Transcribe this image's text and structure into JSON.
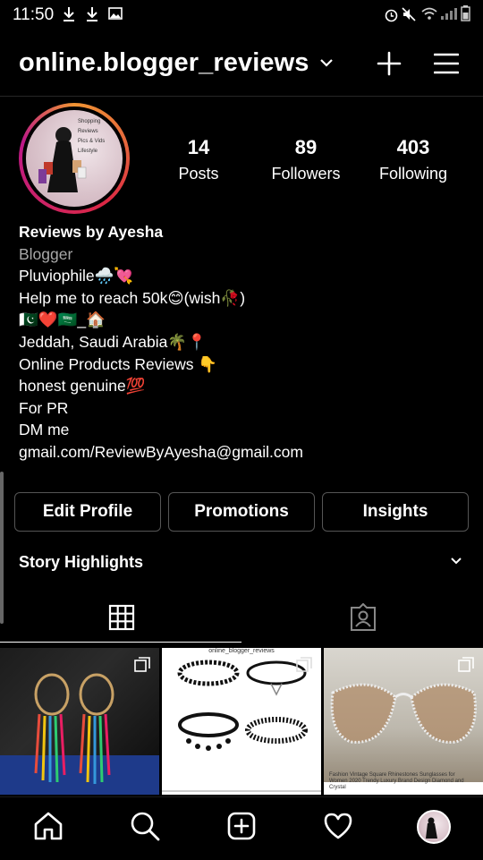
{
  "status_bar": {
    "time": "11:50",
    "left_icons": [
      "download-icon",
      "download-icon",
      "image-icon"
    ],
    "right_icons": [
      "alarm-icon",
      "mute-icon",
      "wifi-icon",
      "signal-icon",
      "battery-icon"
    ]
  },
  "header": {
    "username": "online.blogger_reviews",
    "icons": [
      "chevron-down-icon",
      "plus-icon",
      "menu-icon"
    ]
  },
  "stats": [
    {
      "value": "14",
      "label": "Posts"
    },
    {
      "value": "89",
      "label": "Followers"
    },
    {
      "value": "403",
      "label": "Following"
    }
  ],
  "avatar_text": [
    "Shopping",
    "Reviews",
    "Pics & Vids",
    "Lifestyle"
  ],
  "bio": {
    "name": "Reviews by Ayesha",
    "category": "Blogger",
    "lines": [
      "Pluviophile🌧️💘",
      "Help me to reach 50k😊(wish🥀)",
      "🇵🇰❤️🇸🇦_🏠",
      "Jeddah, Saudi Arabia🌴📍",
      "Online Products Reviews 👇",
      "honest genuine💯",
      "For PR",
      "DM me",
      "gmail.com/ReviewByAyesha@gmail.com"
    ]
  },
  "buttons": {
    "edit_profile": "Edit Profile",
    "promotions": "Promotions",
    "insights": "Insights"
  },
  "story_highlights": "Story Highlights",
  "tabs": [
    "grid-icon",
    "tagged-icon"
  ],
  "posts": [
    {
      "subject": "beaded feather earrings",
      "caption": ""
    },
    {
      "subject": "choker necklaces",
      "caption": "online_blogger_reviews"
    },
    {
      "subject": "rhinestone sunglasses",
      "caption": "Fashion Vintage Square Rhinestones Sunglasses for Women 2020 Trendy Luxury Brand Design Diamond and Crystal"
    }
  ],
  "bottom_nav": [
    "home-icon",
    "search-icon",
    "add-post-icon",
    "heart-icon",
    "profile-avatar"
  ],
  "colors": {
    "background": "#000000",
    "button_border": "#555555",
    "muted_text": "#a8a8a8",
    "story_ring": "#dc2743"
  }
}
